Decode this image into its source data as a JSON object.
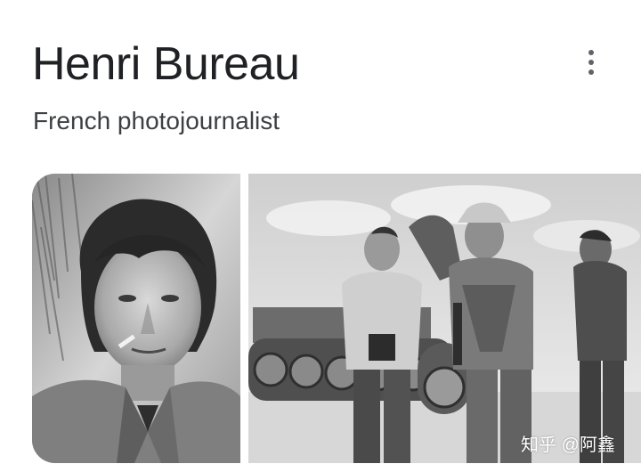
{
  "knowledge_panel": {
    "title": "Henri Bureau",
    "subtitle": "French photojournalist",
    "more_options_icon": "more-vert-icon"
  },
  "photos": [
    {
      "subject": "portrait-with-cigarette",
      "tone": "black-and-white"
    },
    {
      "subject": "photographers-beside-tank",
      "tone": "black-and-white"
    }
  ],
  "watermark": "知乎 @阿鑫"
}
